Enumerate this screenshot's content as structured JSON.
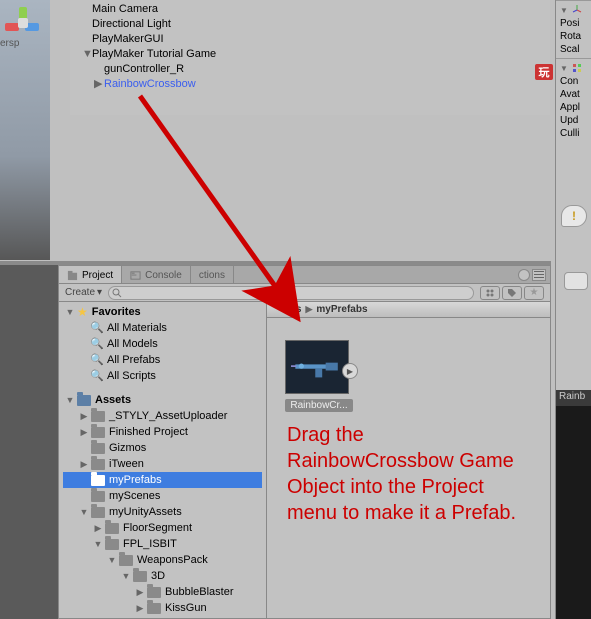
{
  "scene": {
    "persp_label": "ersp"
  },
  "hierarchy": {
    "items": [
      "Main Camera",
      "Directional Light",
      "PlayMakerGUI",
      "PlayMaker Tutorial Game",
      "gunController_R",
      "RainbowCrossbow"
    ]
  },
  "inspector": {
    "transform": [
      "Posi",
      "Rota",
      "Scal"
    ],
    "avatar": [
      "Con",
      "Avat",
      "Appl",
      "Upd",
      "Culli"
    ],
    "lower_label": "Rainb"
  },
  "project": {
    "tabs": {
      "project": "Project",
      "console": "Console",
      "actions": "ctions"
    },
    "create_label": "Create",
    "favorites_label": "Favorites",
    "favorites": [
      "All Materials",
      "All Models",
      "All Prefabs",
      "All Scripts"
    ],
    "assets_label": "Assets",
    "folders": {
      "styly": "_STYLY_AssetUploader",
      "finished": "Finished Project",
      "gizmos": "Gizmos",
      "itween": "iTween",
      "myprefabs": "myPrefabs",
      "myscenes": "myScenes",
      "myunity": "myUnityAssets",
      "floor": "FloorSegment",
      "fpl": "FPL_ISBIT",
      "weapons": "WeaponsPack",
      "threeD": "3D",
      "bubble": "BubbleBlaster",
      "kiss": "KissGun"
    },
    "breadcrumb": {
      "parent": "ets",
      "current": "myPrefabs"
    },
    "asset": {
      "label": "RainbowCr..."
    }
  },
  "annotation": "Drag the RainbowCrossbow Game Object into the Project menu to make it a Prefab.",
  "wan": "玩"
}
